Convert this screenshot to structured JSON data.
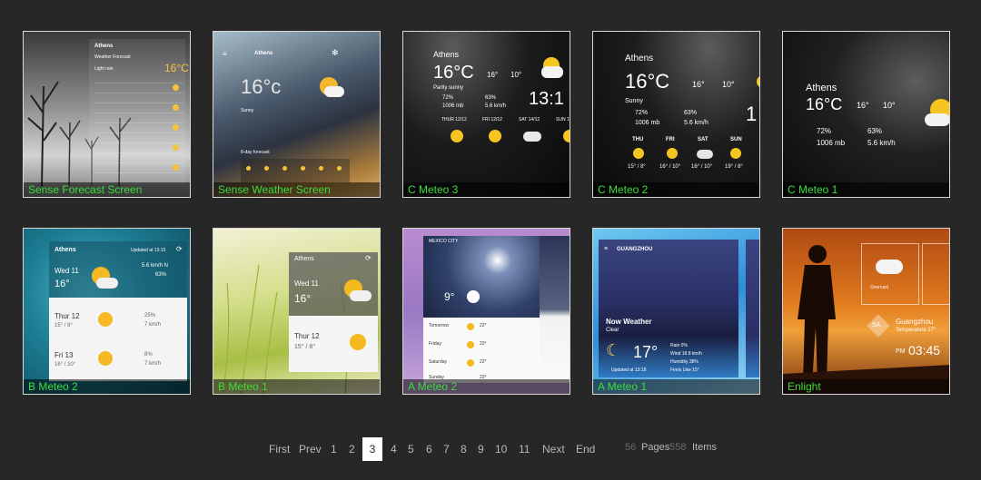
{
  "tiles": [
    {
      "caption": "Sense Forecast Screen",
      "city": "Athens",
      "sub": "Weather Forecast",
      "desc": "Light rain",
      "temp": "16°C"
    },
    {
      "caption": "Sense Weather Screen",
      "city": "Athens",
      "temp": "16°c",
      "desc": "Sunny",
      "extra": "8-day forecast"
    },
    {
      "caption": "C Meteo 3",
      "city": "Athens",
      "temp": "16°C",
      "hi": "16°",
      "lo": "10°",
      "desc": "Partly sunny",
      "hum": "72%",
      "rain": "63%",
      "press": "1006 mb",
      "wind": "5.6 km/h",
      "time": "13:1",
      "days": [
        "THUR 12/12",
        "FRI 12/12",
        "SAT 14/12",
        "SUN 1"
      ]
    },
    {
      "caption": "C Meteo 2",
      "city": "Athens",
      "temp": "16°C",
      "hi": "16°",
      "lo": "10°",
      "desc": "Sunny",
      "hum": "72%",
      "rain": "63%",
      "press": "1006 mb",
      "wind": "5.6 km/h",
      "days": [
        "THU",
        "FRI",
        "SAT",
        "SUN"
      ],
      "ranges": [
        "15° / 8°",
        "16° / 10°",
        "16° / 10°",
        "19° / 8°"
      ]
    },
    {
      "caption": "C Meteo 1",
      "city": "Athens",
      "temp": "16°C",
      "hi": "16°",
      "lo": "10°",
      "hum": "72%",
      "rain": "63%",
      "press": "1006 mb",
      "wind": "5.6 km/h"
    },
    {
      "caption": "B Meteo 2",
      "city": "Athens",
      "updated": "Updated at 13:15",
      "day": "Wed 11",
      "temp": "16°",
      "wind": "5.6 km/h N",
      "rain": "63%",
      "r1": "Thur 12",
      "r1t": "15° / 8°",
      "r1a": "25%",
      "r1b": "7 km/h",
      "r2": "Fri 13",
      "r2t": "16° / 10°",
      "r2a": "8%",
      "r2b": "7 km/h"
    },
    {
      "caption": "B Meteo 1",
      "city": "Athens",
      "day": "Wed 11",
      "temp": "16°",
      "r1": "Thur 12",
      "r1t": "15° / 8°"
    },
    {
      "caption": "A Meteo 2",
      "city": "MEXICO CITY",
      "temp": "9°",
      "rows": [
        "Tomorrow",
        "Friday",
        "Saturday",
        "Sunday"
      ],
      "vals": [
        "22°",
        "23°",
        "22°",
        "23°"
      ]
    },
    {
      "caption": "A Meteo 1",
      "city": "GUANGZHOU",
      "title": "Now Weather",
      "desc": "Clear",
      "temp": "17°",
      "rain": "Rain 0%",
      "wind": "Wind 18.8 km/h",
      "hum": "Humidity 38%",
      "feels": "Feels Like 15°",
      "updated": "Updated at 13:18"
    },
    {
      "caption": "Enlight",
      "desc": "Overcast",
      "city": "Guangzhou",
      "sub": "Temperature 27°",
      "badge": "SA",
      "time": "03:45",
      "ampm": "PM"
    }
  ],
  "pagination": {
    "first": "First",
    "prev": "Prev",
    "pages": [
      "1",
      "2",
      "3",
      "4",
      "5",
      "6",
      "7",
      "8",
      "9",
      "10",
      "11"
    ],
    "active": "3",
    "next": "Next",
    "end": "End",
    "total_pages": "56",
    "pages_label": "Pages",
    "total_items": "558",
    "items_label": "Items"
  }
}
